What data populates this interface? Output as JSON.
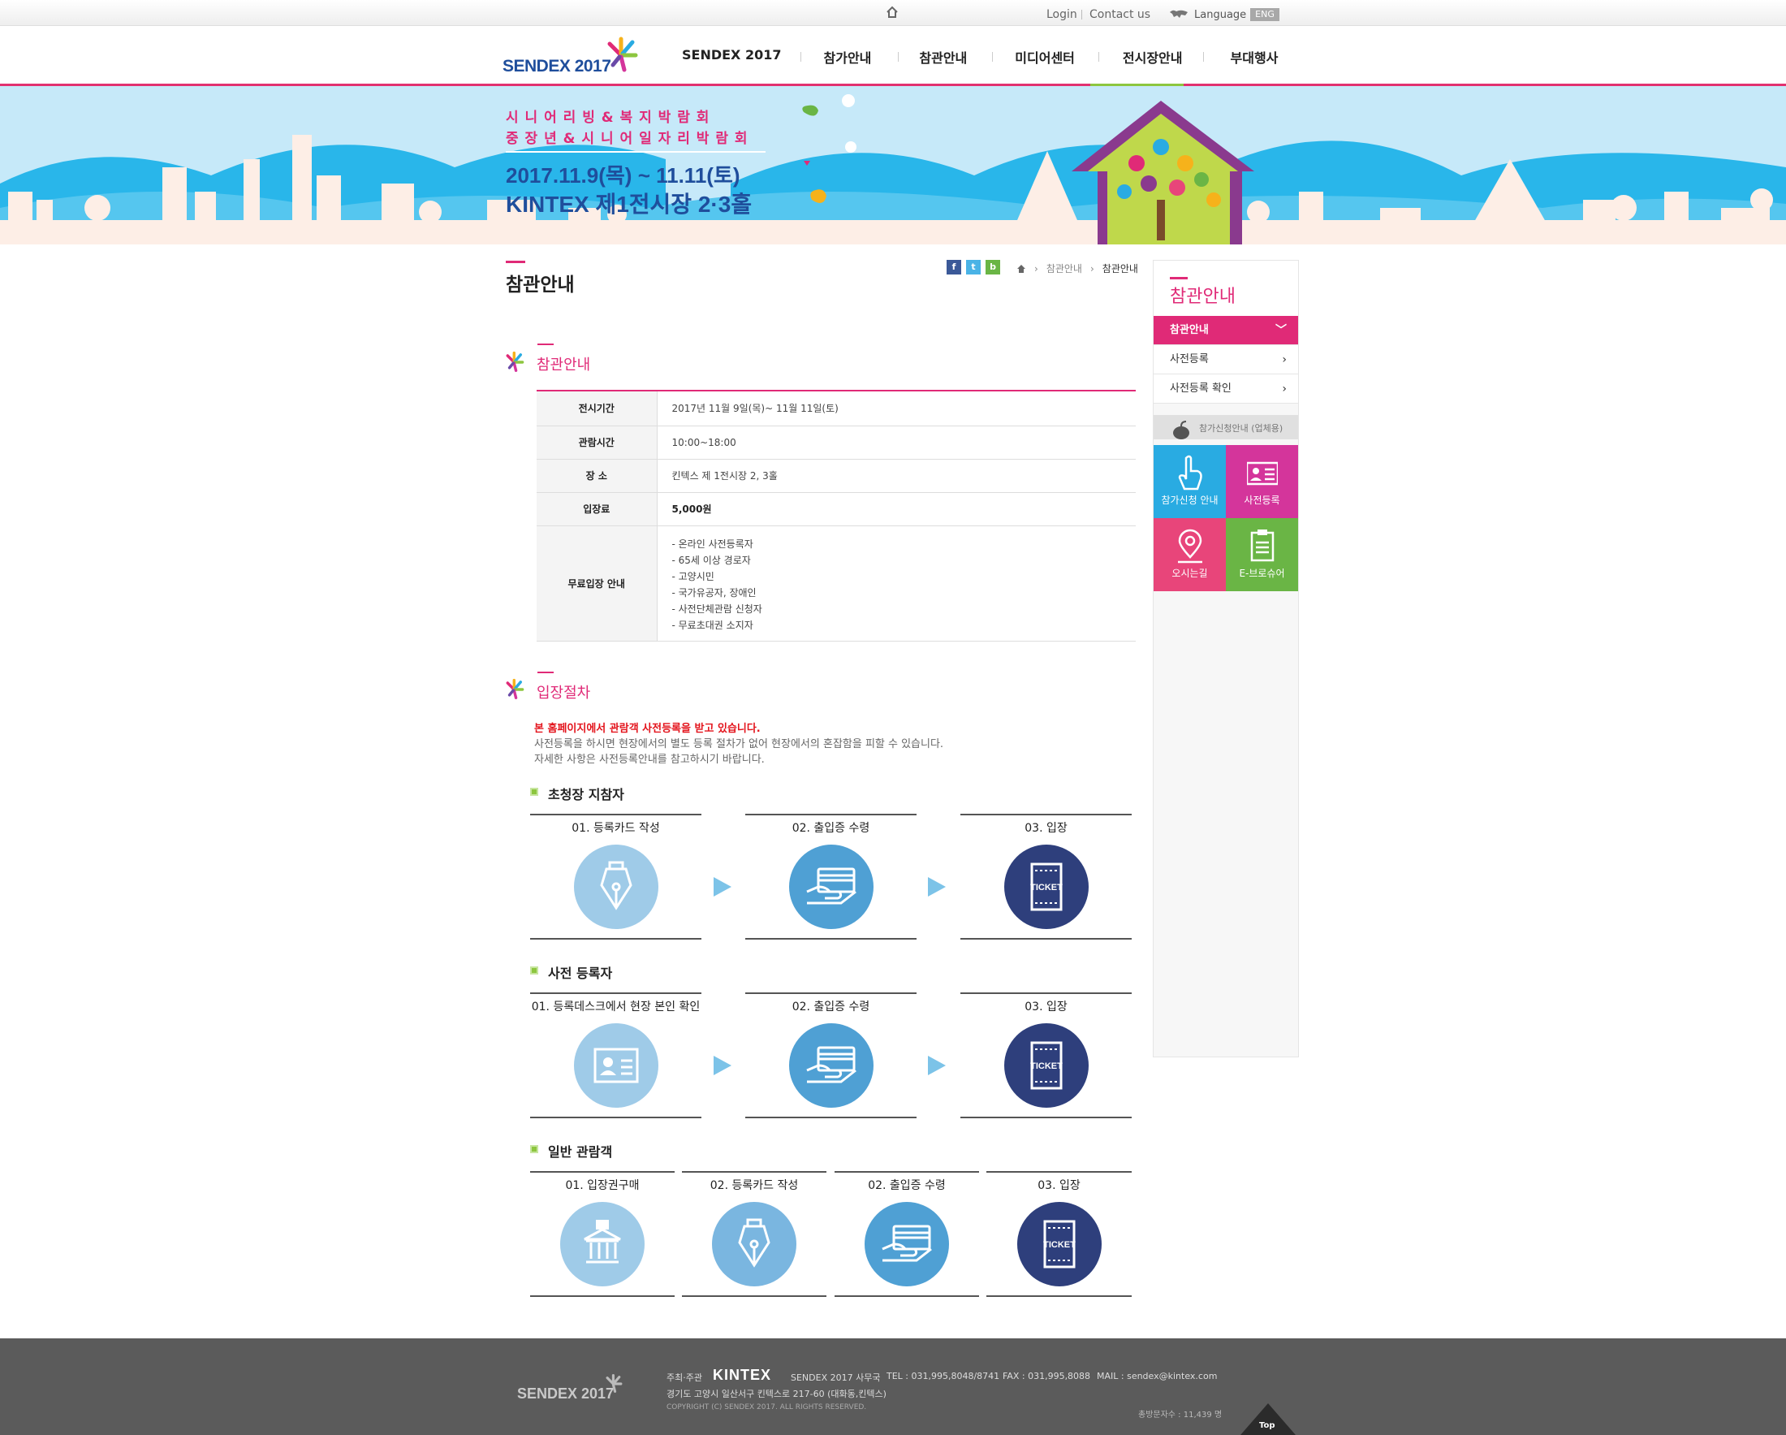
{
  "utility": {
    "login": "Login",
    "contact": "Contact us",
    "language": "Language",
    "eng": "ENG"
  },
  "header": {
    "logo": "SENDEX 2017",
    "menu": [
      "SENDEX 2017",
      "참가안내",
      "참관안내",
      "미디어센터",
      "전시장안내",
      "부대행사"
    ]
  },
  "banner": {
    "line1": "시 니 어 리 빙 & 복 지 박 람 회",
    "line2": "중 장 년 & 시 니 어 일 자 리 박 람 회",
    "date": "2017.11.9(목) ~ 11.11(토)",
    "venue": "KINTEX 제1전시장 2·3홀"
  },
  "page": {
    "title": "참관안내",
    "share": [
      "f",
      "t",
      "b"
    ],
    "breadcrumb": [
      "참관안내",
      "참관안내"
    ]
  },
  "section1": {
    "heading": "참관안내",
    "rows": [
      {
        "label": "전시기간",
        "value": "2017년 11월 9일(목)~ 11월 11일(토)"
      },
      {
        "label": "관람시간",
        "value": "10:00~18:00"
      },
      {
        "label": "장 소",
        "value": "킨텍스 제 1전시장 2, 3홀"
      },
      {
        "label": "입장료",
        "value": "5,000원"
      }
    ],
    "free_label": "무료입장 안내",
    "free_items": [
      "- 온라인 사전등록자",
      "- 65세 이상 경로자",
      "- 고양시민",
      "- 국가유공자, 장애인",
      "- 사전단체관람 신청자",
      "- 무료초대권 소지자"
    ]
  },
  "section2": {
    "heading": "입장절차",
    "notice": "본 홈페이지에서 관람객 사전등록을 받고 있습니다.",
    "desc1": "사전등록을 하시면 현장에서의 별도 등록 절차가 없어 현장에서의 혼잡함을 피할 수 있습니다.",
    "desc2": "자세한 사항은 사전등록안내를 참고하시기 바랍니다.",
    "group1": {
      "title": "초청장 지참자",
      "steps": [
        "01. 등록카드 작성",
        "02. 출입증 수령",
        "03. 입장"
      ]
    },
    "group2": {
      "title": "사전 등록자",
      "steps": [
        "01. 등록데스크에서 현장 본인 확인",
        "02. 출입증 수령",
        "03. 입장"
      ]
    },
    "group3": {
      "title": "일반 관람객",
      "steps": [
        "01. 입장권구매",
        "02. 등록카드 작성",
        "02. 출입증 수령",
        "03. 입장"
      ]
    },
    "ticket": "TICKET"
  },
  "sidebar": {
    "title": "참관안내",
    "items": [
      "참관안내",
      "사전등록",
      "사전등록 확인"
    ],
    "notice": "참가신청안내 (업체용)",
    "tiles": [
      {
        "label": "참가신청 안내",
        "color": "#29abe2"
      },
      {
        "label": "사전등록",
        "color": "#d4359b"
      },
      {
        "label": "오시는길",
        "color": "#e8457a"
      },
      {
        "label": "E-브로슈어",
        "color": "#6ab545"
      }
    ]
  },
  "footer": {
    "logo": "SENDEX 2017",
    "host_label": "주최·주관",
    "host": "KINTEX",
    "office": "SENDEX 2017 사무국",
    "tel": "TEL : 031,995,8048/8741",
    "fax": "FAX : 031,995,8088",
    "mail": "MAIL : sendex@kintex.com",
    "address": "경기도 고양시 일산서구 킨텍스로 217-60 (대화동,킨텍스)",
    "copyright": "COPYRIGHT (C) SENDEX 2017.   ALL RIGHTS RESERVED.",
    "visitors": "총방문자수 : 11,439 명",
    "top": "Top"
  },
  "colors": {
    "accent": "#e02a77",
    "green": "#8dc63f",
    "navy": "#2e3f7c",
    "light_blue": "#9fcbe8",
    "mid_blue": "#4fa0d4"
  }
}
